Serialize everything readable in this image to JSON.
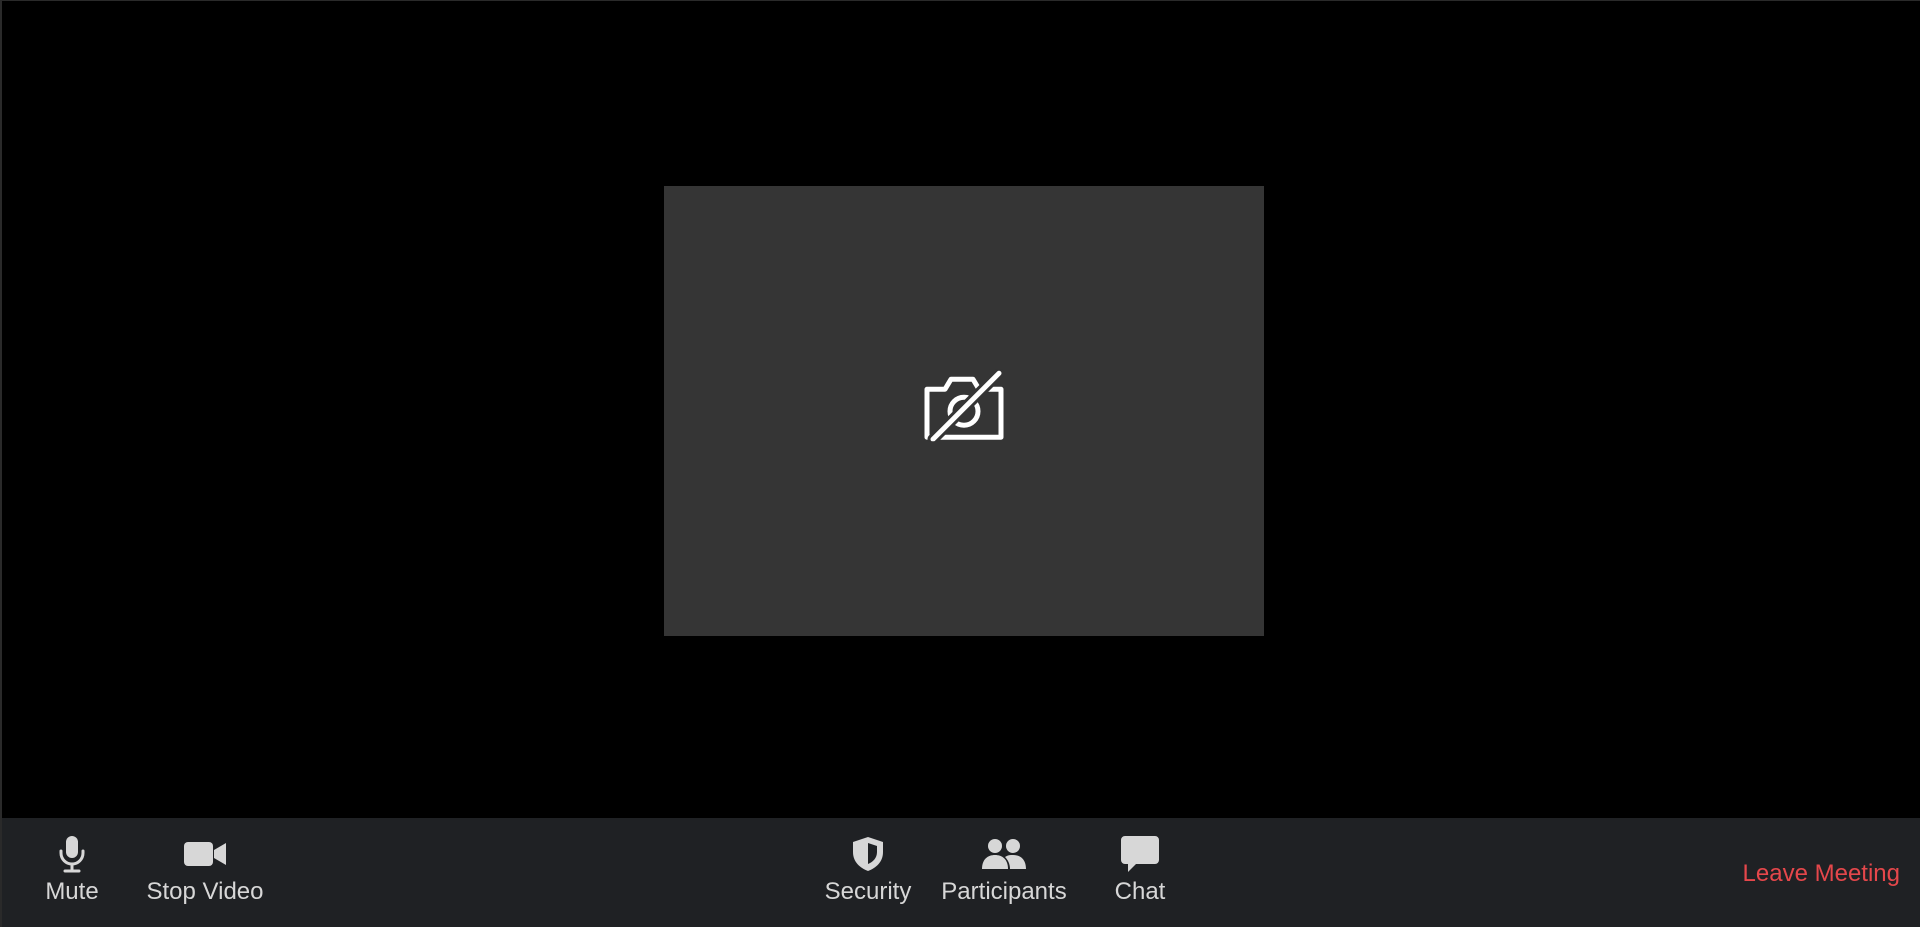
{
  "video": {
    "camera_state_icon": "camera-off-icon"
  },
  "toolbar": {
    "mute": {
      "label": "Mute",
      "icon": "microphone-icon"
    },
    "stop_video": {
      "label": "Stop Video",
      "icon": "video-camera-icon"
    },
    "security": {
      "label": "Security",
      "icon": "shield-icon"
    },
    "participants": {
      "label": "Participants",
      "icon": "people-icon"
    },
    "chat": {
      "label": "Chat",
      "icon": "chat-bubble-icon"
    },
    "leave": {
      "label": "Leave Meeting",
      "color": "#e5474b"
    }
  },
  "colors": {
    "background": "#000000",
    "video_tile": "#353535",
    "toolbar": "#1f2124",
    "toolbar_text": "#d7d7d7"
  }
}
